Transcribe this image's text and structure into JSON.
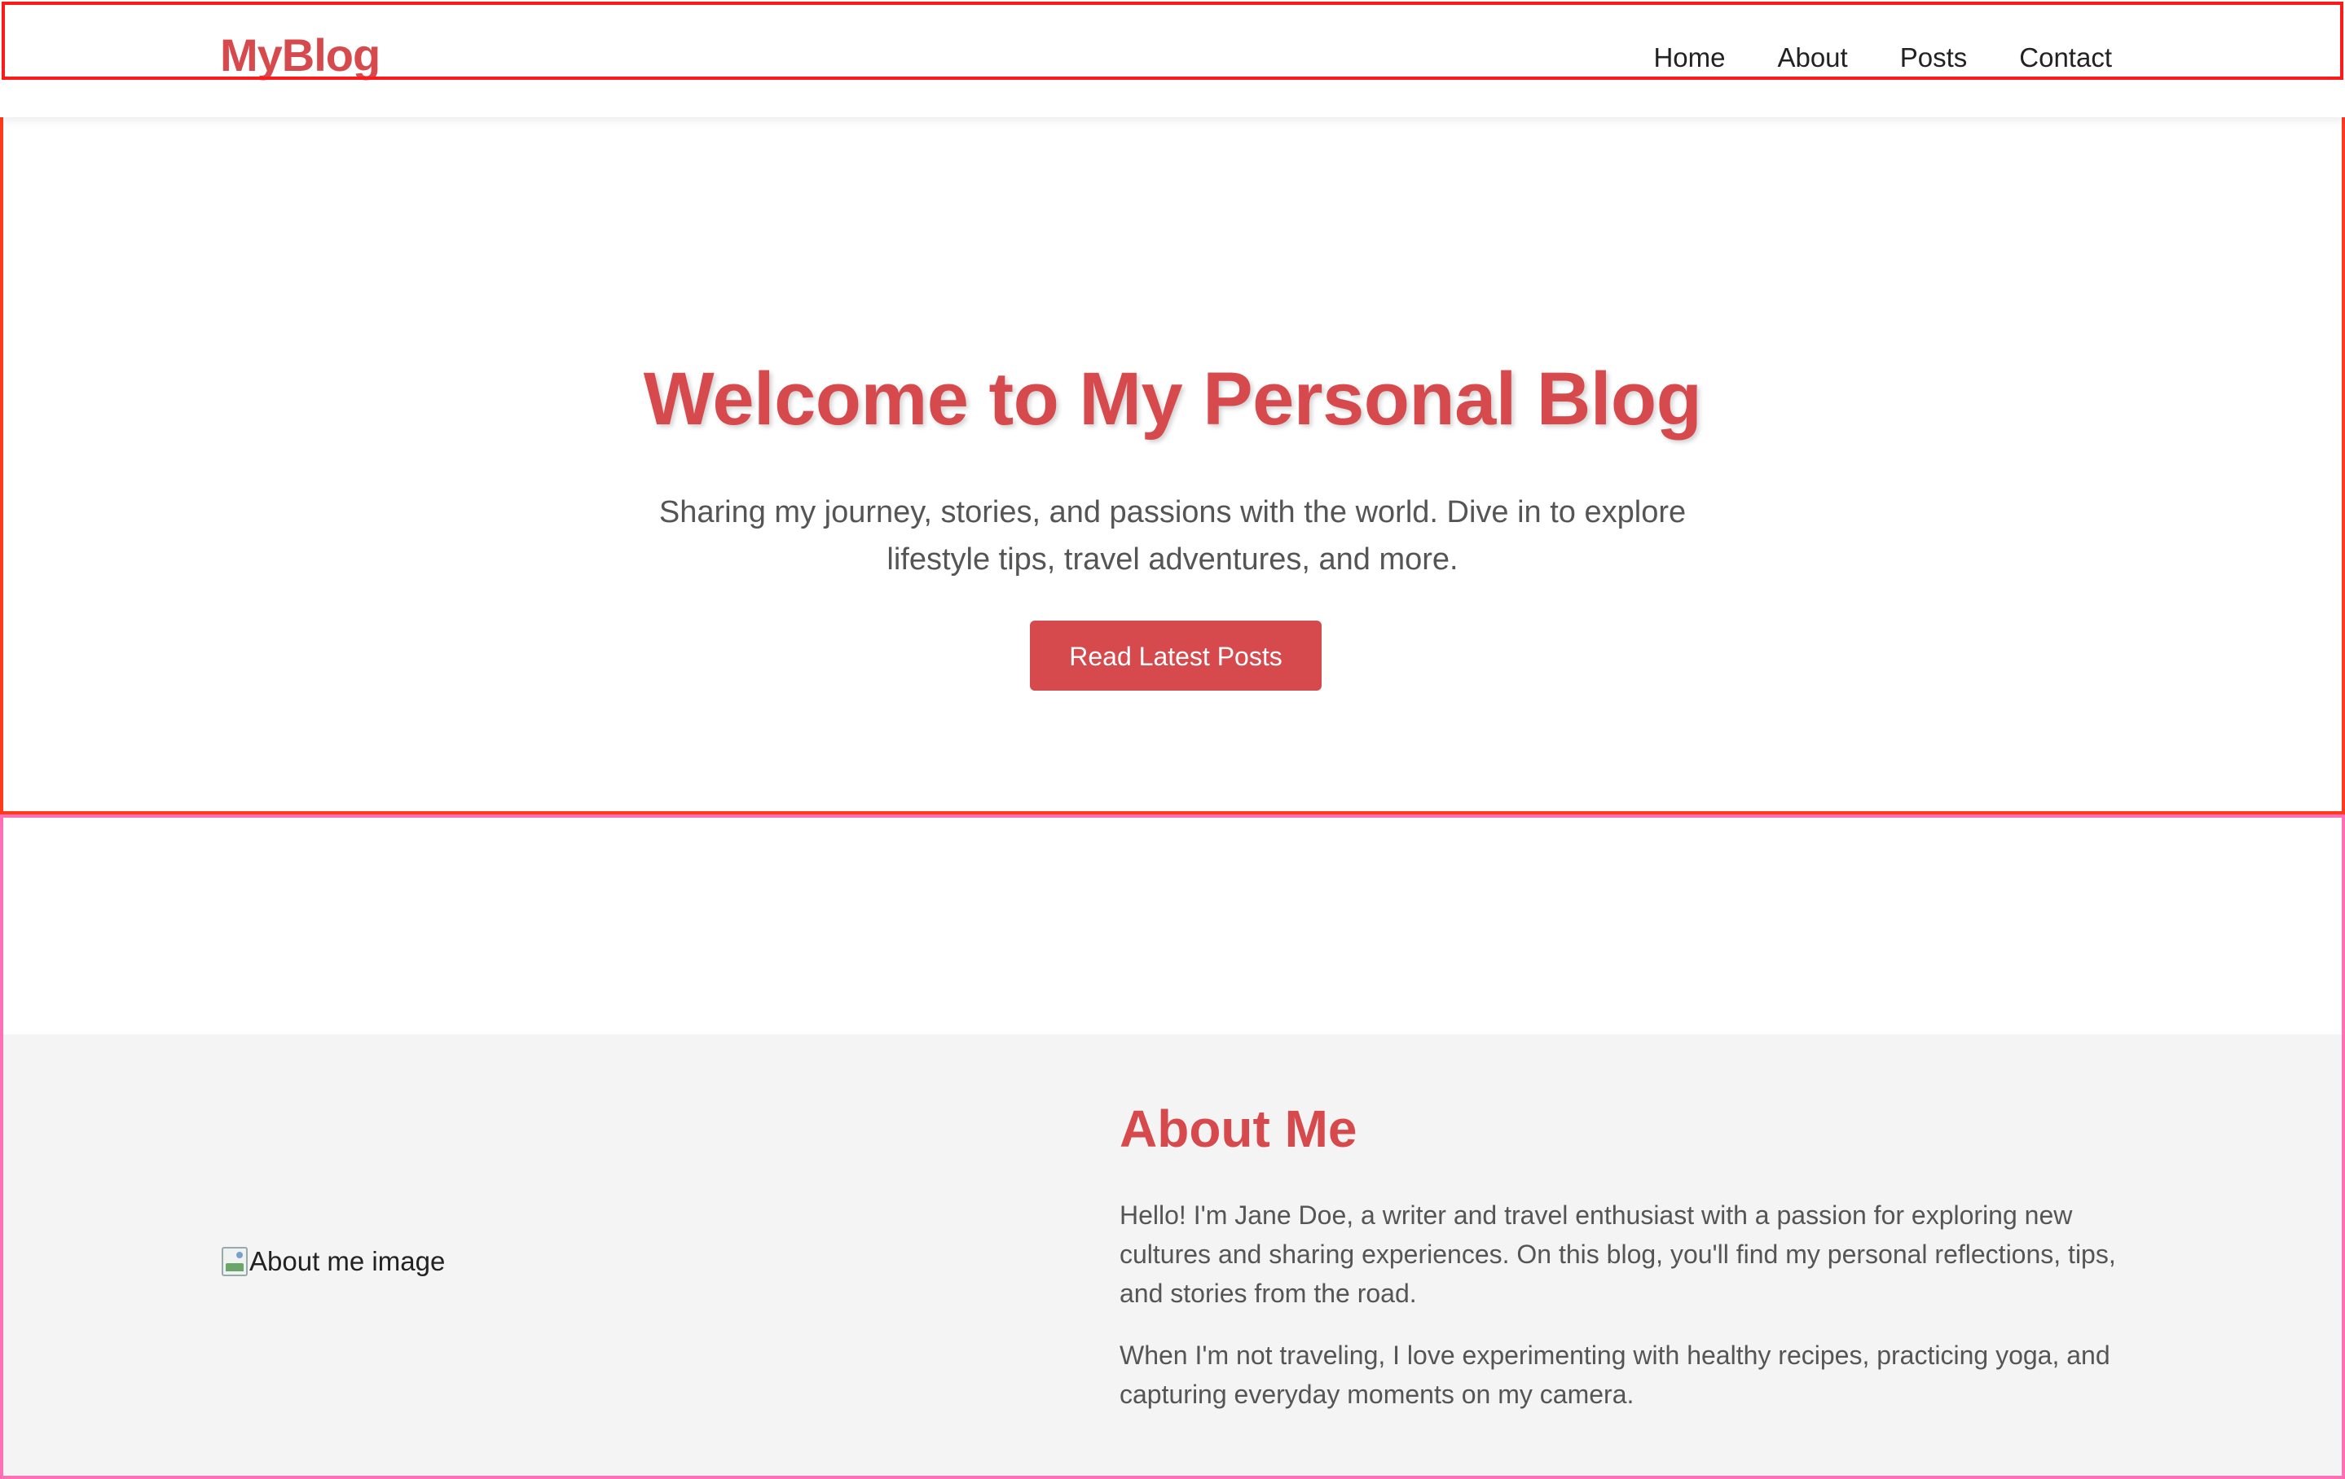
{
  "header": {
    "logo": "MyBlog",
    "nav": [
      "Home",
      "About",
      "Posts",
      "Contact"
    ]
  },
  "hero": {
    "title": "Welcome to My Personal Blog",
    "subtitle": "Sharing my journey, stories, and passions with the world. Dive in to explore lifestyle tips, travel adventures, and more.",
    "button_label": "Read Latest Posts"
  },
  "about": {
    "image_alt": "About me image",
    "title": "About Me",
    "paragraphs": [
      "Hello! I'm Jane Doe, a writer and travel enthusiast with a passion for exploring new cultures and sharing experiences. On this blog, you'll find my personal reflections, tips, and stories from the road.",
      "When I'm not traveling, I love experimenting with healthy recipes, practicing yoga, and capturing everyday moments on my camera."
    ]
  },
  "colors": {
    "accent": "#d64a4e",
    "about_bg": "#f4f4f4",
    "text_muted": "#555555"
  }
}
